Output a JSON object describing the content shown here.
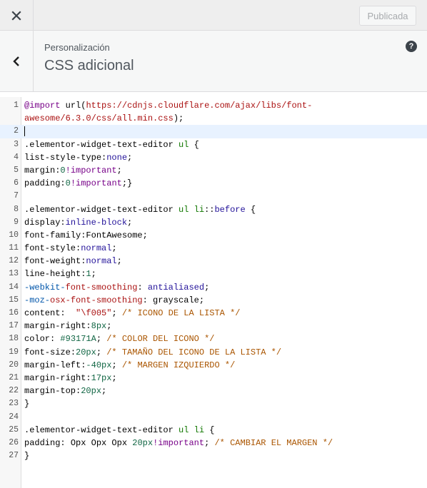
{
  "topbar": {
    "close_icon": "close-icon",
    "publish_label": "Publicada"
  },
  "section": {
    "breadcrumb": "Personalización",
    "title": "CSS adicional",
    "back_icon": "chevron-left-icon",
    "help_icon": "help-icon",
    "help_glyph": "?"
  },
  "editor": {
    "lines": [
      {
        "n": "1",
        "tokens": [
          [
            "t-kw",
            "@import"
          ],
          [
            "t-plain",
            " url("
          ],
          [
            "t-url",
            "https://cdnjs.cloudflare.com/ajax/libs/font-"
          ]
        ]
      },
      {
        "n": "",
        "tokens": [
          [
            "t-url",
            "awesome/6.3.0/css/all.min.css"
          ],
          [
            "t-plain",
            ");"
          ]
        ]
      },
      {
        "n": "2",
        "tokens": [],
        "cursor": true
      },
      {
        "n": "3",
        "tokens": [
          [
            "t-sel",
            ".elementor-widget-text-editor"
          ],
          [
            "t-plain",
            " "
          ],
          [
            "t-tag",
            "ul"
          ],
          [
            "t-plain",
            " {"
          ]
        ]
      },
      {
        "n": "4",
        "tokens": [
          [
            "t-prop",
            "list-style-type"
          ],
          [
            "t-plain",
            ":"
          ],
          [
            "t-val",
            "none"
          ],
          [
            "t-plain",
            ";"
          ]
        ]
      },
      {
        "n": "5",
        "tokens": [
          [
            "t-prop",
            "margin"
          ],
          [
            "t-plain",
            ":"
          ],
          [
            "t-num",
            "0"
          ],
          [
            "t-imp",
            "!important"
          ],
          [
            "t-plain",
            ";"
          ]
        ]
      },
      {
        "n": "6",
        "tokens": [
          [
            "t-prop",
            "padding"
          ],
          [
            "t-plain",
            ":"
          ],
          [
            "t-num",
            "0"
          ],
          [
            "t-imp",
            "!important"
          ],
          [
            "t-plain",
            ";}"
          ]
        ]
      },
      {
        "n": "7",
        "tokens": []
      },
      {
        "n": "8",
        "tokens": [
          [
            "t-sel",
            ".elementor-widget-text-editor"
          ],
          [
            "t-plain",
            " "
          ],
          [
            "t-tag",
            "ul"
          ],
          [
            "t-plain",
            " "
          ],
          [
            "t-tag",
            "li"
          ],
          [
            "t-plain",
            "::"
          ],
          [
            "t-pseudo",
            "before"
          ],
          [
            "t-plain",
            " {"
          ]
        ]
      },
      {
        "n": "9",
        "tokens": [
          [
            "t-prop",
            "display"
          ],
          [
            "t-plain",
            ":"
          ],
          [
            "t-val",
            "inline-block"
          ],
          [
            "t-plain",
            ";"
          ]
        ]
      },
      {
        "n": "10",
        "tokens": [
          [
            "t-prop",
            "font-family"
          ],
          [
            "t-plain",
            ":FontAwesome;"
          ]
        ]
      },
      {
        "n": "11",
        "tokens": [
          [
            "t-prop",
            "font-style"
          ],
          [
            "t-plain",
            ":"
          ],
          [
            "t-val",
            "normal"
          ],
          [
            "t-plain",
            ";"
          ]
        ]
      },
      {
        "n": "12",
        "tokens": [
          [
            "t-prop",
            "font-weight"
          ],
          [
            "t-plain",
            ":"
          ],
          [
            "t-val",
            "normal"
          ],
          [
            "t-plain",
            ";"
          ]
        ]
      },
      {
        "n": "13",
        "tokens": [
          [
            "t-prop",
            "line-height"
          ],
          [
            "t-plain",
            ":"
          ],
          [
            "t-num",
            "1"
          ],
          [
            "t-plain",
            ";"
          ]
        ]
      },
      {
        "n": "14",
        "tokens": [
          [
            "t-vendor",
            "-webkit-"
          ],
          [
            "t-unk",
            "font-smoothing"
          ],
          [
            "t-plain",
            ": "
          ],
          [
            "t-val",
            "antialiased"
          ],
          [
            "t-plain",
            ";"
          ]
        ]
      },
      {
        "n": "15",
        "tokens": [
          [
            "t-vendor",
            "-moz-"
          ],
          [
            "t-unk",
            "osx-font-smoothing"
          ],
          [
            "t-plain",
            ": grayscale;"
          ]
        ]
      },
      {
        "n": "16",
        "tokens": [
          [
            "t-prop",
            "content"
          ],
          [
            "t-plain",
            ":  "
          ],
          [
            "t-str",
            "\"\\f005\""
          ],
          [
            "t-plain",
            "; "
          ],
          [
            "t-com",
            "/* ICONO DE LA LISTA */"
          ]
        ]
      },
      {
        "n": "17",
        "tokens": [
          [
            "t-prop",
            "margin-right"
          ],
          [
            "t-plain",
            ":"
          ],
          [
            "t-num",
            "8px"
          ],
          [
            "t-plain",
            ";"
          ]
        ]
      },
      {
        "n": "18",
        "tokens": [
          [
            "t-prop",
            "color"
          ],
          [
            "t-plain",
            ": "
          ],
          [
            "t-num",
            "#93171A"
          ],
          [
            "t-plain",
            "; "
          ],
          [
            "t-com",
            "/* COLOR DEL ICONO */"
          ]
        ]
      },
      {
        "n": "19",
        "tokens": [
          [
            "t-prop",
            "font-size"
          ],
          [
            "t-plain",
            ":"
          ],
          [
            "t-num",
            "20px"
          ],
          [
            "t-plain",
            "; "
          ],
          [
            "t-com",
            "/* TAMAÑO DEL ICONO DE LA LISTA */"
          ]
        ]
      },
      {
        "n": "20",
        "tokens": [
          [
            "t-prop",
            "margin-left"
          ],
          [
            "t-plain",
            ":"
          ],
          [
            "t-num",
            "-40px"
          ],
          [
            "t-plain",
            "; "
          ],
          [
            "t-com",
            "/* MARGEN IZQUIERDO */"
          ]
        ]
      },
      {
        "n": "21",
        "tokens": [
          [
            "t-prop",
            "margin-right"
          ],
          [
            "t-plain",
            ":"
          ],
          [
            "t-num",
            "17px"
          ],
          [
            "t-plain",
            ";"
          ]
        ]
      },
      {
        "n": "22",
        "tokens": [
          [
            "t-prop",
            "margin-top"
          ],
          [
            "t-plain",
            ":"
          ],
          [
            "t-num",
            "20px"
          ],
          [
            "t-plain",
            ";"
          ]
        ]
      },
      {
        "n": "23",
        "tokens": [
          [
            "t-plain",
            "}"
          ]
        ]
      },
      {
        "n": "24",
        "tokens": []
      },
      {
        "n": "25",
        "tokens": [
          [
            "t-sel",
            ".elementor-widget-text-editor"
          ],
          [
            "t-plain",
            " "
          ],
          [
            "t-tag",
            "ul"
          ],
          [
            "t-plain",
            " "
          ],
          [
            "t-tag",
            "li"
          ],
          [
            "t-plain",
            " {"
          ]
        ]
      },
      {
        "n": "26",
        "tokens": [
          [
            "t-prop",
            "padding"
          ],
          [
            "t-plain",
            ": Opx Opx Opx "
          ],
          [
            "t-num",
            "20px"
          ],
          [
            "t-imp",
            "!important"
          ],
          [
            "t-plain",
            "; "
          ],
          [
            "t-com",
            "/* CAMBIAR EL MARGEN */"
          ]
        ]
      },
      {
        "n": "27",
        "tokens": [
          [
            "t-plain",
            "}"
          ]
        ]
      }
    ]
  }
}
